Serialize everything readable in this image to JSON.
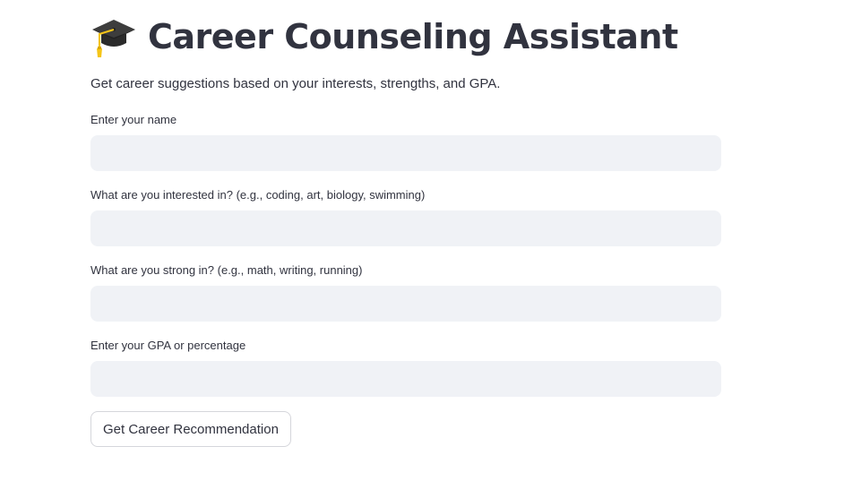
{
  "header": {
    "icon": "graduation-cap-icon",
    "title": "Career Counseling Assistant",
    "subtitle": "Get career suggestions based on your interests, strengths, and GPA."
  },
  "form": {
    "name_label": "Enter your name",
    "name_value": "",
    "interests_label": "What are you interested in? (e.g., coding, art, biology, swimming)",
    "interests_value": "",
    "strengths_label": "What are you strong in? (e.g., math, writing, running)",
    "strengths_value": "",
    "gpa_label": "Enter your GPA or percentage",
    "gpa_value": "",
    "submit_label": "Get Career Recommendation"
  },
  "colors": {
    "text": "#31333f",
    "input_bg": "#f0f2f6",
    "button_border": "#d5d6db",
    "cap_dark": "#3a3a3a",
    "cap_tassel": "#f5c518"
  }
}
